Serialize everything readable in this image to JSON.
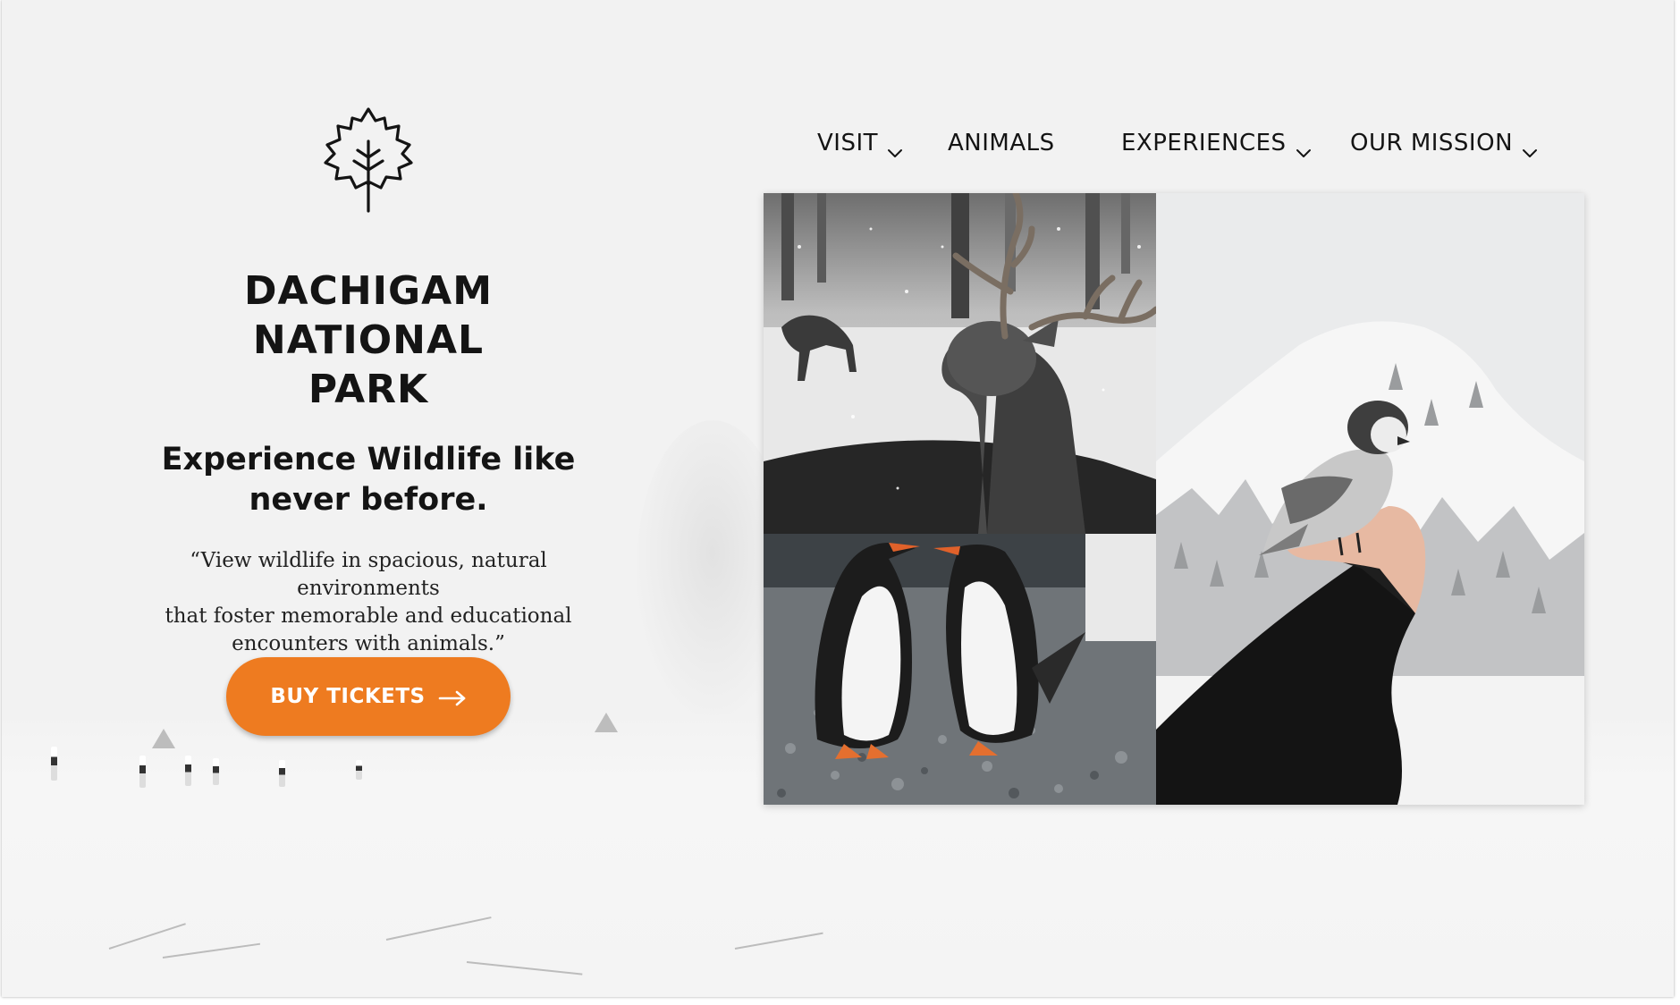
{
  "brand": {
    "logo_icon": "maple-leaf-icon",
    "title_lines": [
      "DACHIGAM",
      "NATIONAL",
      "PARK"
    ]
  },
  "hero": {
    "tagline_lines": [
      "Experience Wildlife like",
      "never before."
    ],
    "quote_lines": [
      "“View wildlife in spacious, natural environments",
      "that foster memorable and educational",
      "encounters with animals.”"
    ],
    "cta_label": "BUY TICKETS",
    "cta_icon": "arrow-right-icon"
  },
  "nav": {
    "items": [
      {
        "label": "VISIT",
        "has_dropdown": true
      },
      {
        "label": "ANIMALS",
        "has_dropdown": false
      },
      {
        "label": "EXPERIENCES",
        "has_dropdown": true
      },
      {
        "label": "OUR MISSION",
        "has_dropdown": true
      }
    ],
    "dropdown_icon": "chevron-down-icon"
  },
  "gallery": {
    "photos": [
      {
        "subject": "deer-in-snow-photo"
      },
      {
        "subject": "penguins-photo"
      },
      {
        "subject": "bird-on-hand-photo"
      }
    ]
  },
  "colors": {
    "accent": "#ee7b20",
    "text": "#141414",
    "background": "#f2f2f2"
  }
}
